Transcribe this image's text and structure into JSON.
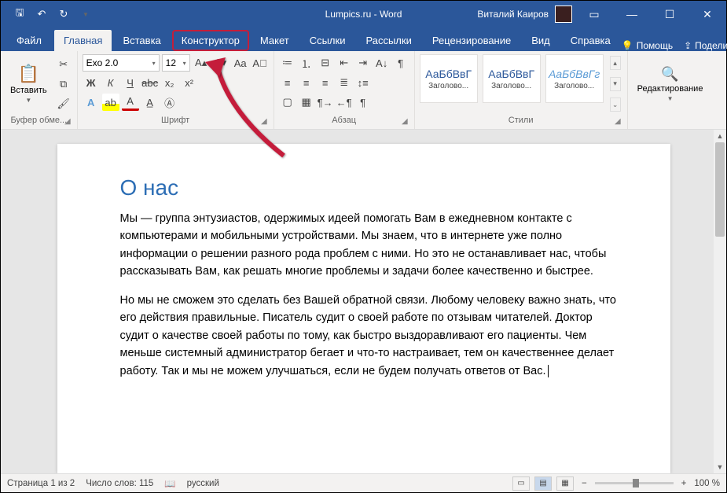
{
  "titlebar": {
    "title": "Lumpics.ru - Word",
    "user": "Виталий Каиров"
  },
  "tabs": {
    "file": "Файл",
    "items": [
      "Главная",
      "Вставка",
      "Конструктор",
      "Макет",
      "Ссылки",
      "Рассылки",
      "Рецензирование",
      "Вид",
      "Справка"
    ],
    "help": "Помощь",
    "share": "Поделиться"
  },
  "ribbon": {
    "clipboard": {
      "paste": "Вставить",
      "label": "Буфер обме..."
    },
    "font": {
      "name": "Exo 2.0",
      "size": "12",
      "label": "Шрифт"
    },
    "paragraph": {
      "label": "Абзац"
    },
    "styles": {
      "label": "Стили",
      "items": [
        {
          "sample": "АаБбВвГ",
          "name": "Заголово..."
        },
        {
          "sample": "АаБбВвГ",
          "name": "Заголово..."
        },
        {
          "sample": "АаБбВвГг",
          "name": "Заголово..."
        }
      ]
    },
    "editing": {
      "label": "Редактирование"
    }
  },
  "document": {
    "heading": "О нас",
    "p1": "Мы — группа энтузиастов, одержимых идеей помогать Вам в ежедневном контакте с компьютерами и мобильными устройствами. Мы знаем, что в интернете уже полно информации о решении разного рода проблем с ними. Но это не останавливает нас, чтобы рассказывать Вам, как решать многие проблемы и задачи более качественно и быстрее.",
    "p2": "Но мы не сможем это сделать без Вашей обратной связи. Любому человеку важно знать, что его действия правильные. Писатель судит о своей работе по отзывам читателей. Доктор судит о качестве своей работы по тому, как быстро выздоравливают его пациенты. Чем меньше системный администратор бегает и что-то настраивает, тем он качественнее делает работу. Так и мы не можем улучшаться, если не будем получать ответов от Вас."
  },
  "statusbar": {
    "page": "Страница 1 из 2",
    "words": "Число слов: 115",
    "language": "русский",
    "zoom": "100 %"
  }
}
